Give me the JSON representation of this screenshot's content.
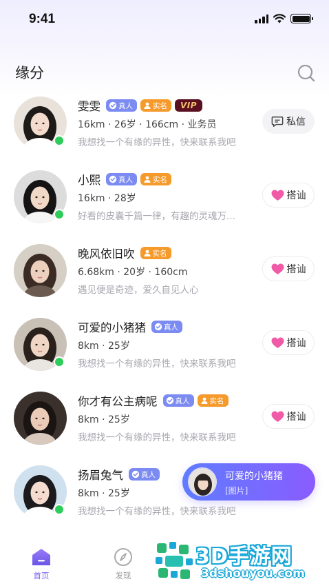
{
  "status_bar": {
    "time": "9:41"
  },
  "header": {
    "title": "缘分",
    "search_icon": "search-icon"
  },
  "users": [
    {
      "name": "雯雯",
      "badges": [
        "real",
        "verified",
        "vip"
      ],
      "info": "16km · 26岁 · 166cm · 业务员",
      "bio": "我想找一个有缘的异性，快来联系我吧",
      "online": true,
      "action": "私信",
      "action_type": "message"
    },
    {
      "name": "小熙",
      "badges": [
        "real",
        "verified"
      ],
      "info": "16km · 28岁",
      "bio": "好看的皮囊千篇一律，有趣的灵魂万...",
      "online": true,
      "action": "搭讪",
      "action_type": "greet"
    },
    {
      "name": "晚风依旧吹",
      "badges": [
        "verified"
      ],
      "info": "6.68km · 20岁 · 160cm",
      "bio": "遇见便是奇迹，爱久自见人心",
      "online": false,
      "action": "搭讪",
      "action_type": "greet"
    },
    {
      "name": "可爱的小猪猪",
      "badges": [
        "real"
      ],
      "info": "8km · 25岁",
      "bio": "我想找一个有缘的异性，快来联系我吧",
      "online": true,
      "action": "搭讪",
      "action_type": "greet"
    },
    {
      "name": "你才有公主病呢",
      "badges": [
        "real",
        "verified"
      ],
      "info": "8km · 25岁",
      "bio": "我想找一个有缘的异性，快来联系我吧",
      "online": false,
      "action": "搭讪",
      "action_type": "greet"
    },
    {
      "name": "扬眉兔气",
      "badges": [
        "real"
      ],
      "info": "8km · 25岁",
      "bio": "我想找一个有缘的异性，快来联系我吧",
      "online": true,
      "action": "",
      "action_type": "none"
    }
  ],
  "badge_labels": {
    "real": "真人",
    "verified": "实名",
    "vip": "VIP"
  },
  "toast": {
    "name": "可爱的小猪猪",
    "message": "[图片]"
  },
  "tabbar": {
    "home": "首页",
    "discover": "发现"
  },
  "watermark": {
    "brand": "3D手游网",
    "url": "3dshouyou.com"
  },
  "colors": {
    "accent": "#7a63f0",
    "real_badge": "#7b8bf2",
    "verified_badge": "#f59a2b",
    "online": "#2ecc5a",
    "heart": "#f05aa6"
  }
}
